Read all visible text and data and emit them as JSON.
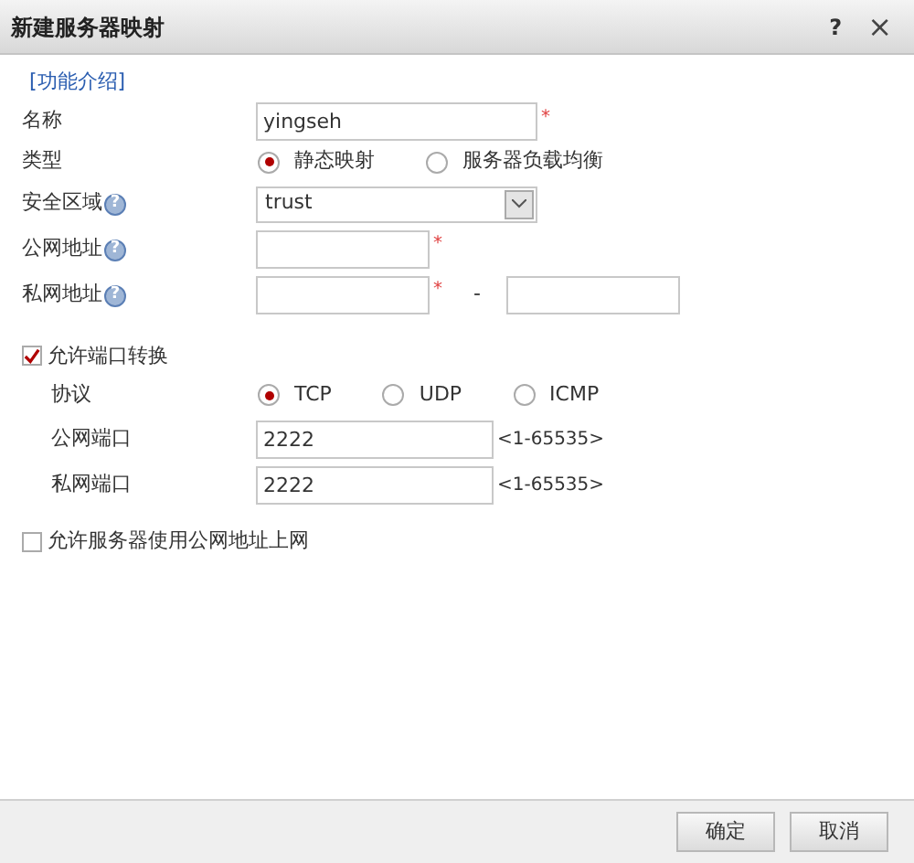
{
  "window": {
    "title": "新建服务器映射",
    "help": "?",
    "close": "×"
  },
  "intro_link": "[功能介绍]",
  "name": {
    "label": "名称",
    "value": "yingseh",
    "required": "*"
  },
  "type": {
    "label": "类型",
    "options": [
      {
        "label": "静态映射",
        "selected": true
      },
      {
        "label": "服务器负载均衡",
        "selected": false
      }
    ]
  },
  "zone": {
    "label": "安全区域",
    "help": "?",
    "value": "trust"
  },
  "public_address": {
    "label": "公网地址",
    "help": "?",
    "required": "*"
  },
  "private_address": {
    "label": "私网地址",
    "help": "?",
    "required": "*",
    "separator": "-"
  },
  "port_translation": {
    "label": "允许端口转换",
    "checked": true,
    "protocol": {
      "label": "协议",
      "options": [
        {
          "label": "TCP",
          "selected": true
        },
        {
          "label": "UDP",
          "selected": false
        },
        {
          "label": "ICMP",
          "selected": false
        }
      ]
    },
    "public_port": {
      "label": "公网端口",
      "value": "2222",
      "range": "<1-65535>"
    },
    "private_port": {
      "label": "私网端口",
      "value": "2222",
      "range": "<1-65535>"
    }
  },
  "allow_public_internet": {
    "label": "允许服务器使用公网地址上网",
    "checked": false
  },
  "buttons": [
    "确定",
    "取消"
  ]
}
